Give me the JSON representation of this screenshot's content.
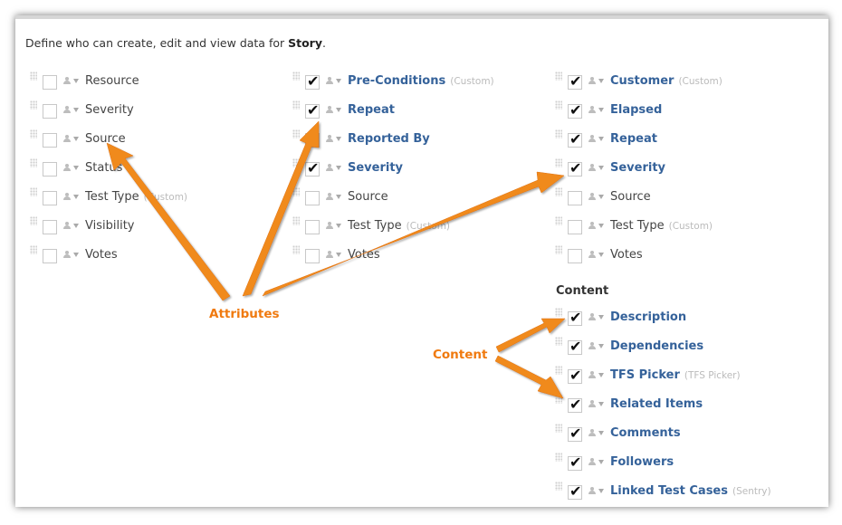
{
  "intro": {
    "prefix": "Define who can create, edit and view data for ",
    "entity": "Story",
    "suffix": "."
  },
  "columns": [
    {
      "items": [
        {
          "label": "Resource",
          "checked": false,
          "tag": ""
        },
        {
          "label": "Severity",
          "checked": false,
          "tag": ""
        },
        {
          "label": "Source",
          "checked": false,
          "tag": ""
        },
        {
          "label": "Status",
          "checked": false,
          "tag": ""
        },
        {
          "label": "Test Type",
          "checked": false,
          "tag": "(Custom)"
        },
        {
          "label": "Visibility",
          "checked": false,
          "tag": ""
        },
        {
          "label": "Votes",
          "checked": false,
          "tag": ""
        }
      ]
    },
    {
      "items": [
        {
          "label": "Pre-Conditions",
          "checked": true,
          "tag": "(Custom)"
        },
        {
          "label": "Repeat",
          "checked": true,
          "tag": ""
        },
        {
          "label": "Reported By",
          "checked": true,
          "tag": ""
        },
        {
          "label": "Severity",
          "checked": true,
          "tag": ""
        },
        {
          "label": "Source",
          "checked": false,
          "tag": ""
        },
        {
          "label": "Test Type",
          "checked": false,
          "tag": "(Custom)"
        },
        {
          "label": "Votes",
          "checked": false,
          "tag": ""
        }
      ]
    },
    {
      "items": [
        {
          "label": "Customer",
          "checked": true,
          "tag": "(Custom)"
        },
        {
          "label": "Elapsed",
          "checked": true,
          "tag": ""
        },
        {
          "label": "Repeat",
          "checked": true,
          "tag": ""
        },
        {
          "label": "Severity",
          "checked": true,
          "tag": ""
        },
        {
          "label": "Source",
          "checked": false,
          "tag": ""
        },
        {
          "label": "Test Type",
          "checked": false,
          "tag": "(Custom)"
        },
        {
          "label": "Votes",
          "checked": false,
          "tag": ""
        }
      ]
    }
  ],
  "content_section": {
    "title": "Content",
    "items": [
      {
        "label": "Description",
        "checked": true,
        "tag": ""
      },
      {
        "label": "Dependencies",
        "checked": true,
        "tag": ""
      },
      {
        "label": "TFS Picker",
        "checked": true,
        "tag": "(TFS Picker)"
      },
      {
        "label": "Related Items",
        "checked": true,
        "tag": ""
      },
      {
        "label": "Comments",
        "checked": true,
        "tag": ""
      },
      {
        "label": "Followers",
        "checked": true,
        "tag": ""
      },
      {
        "label": "Linked Test Cases",
        "checked": true,
        "tag": "(Sentry)"
      }
    ]
  },
  "annotations": {
    "attributes": "Attributes",
    "content": "Content"
  },
  "colors": {
    "accent": "#f07a0f",
    "link": "#35629a"
  },
  "icons": {
    "drag": "drag-handle-icon",
    "role": "person-icon",
    "dropdown": "chevron-down-icon",
    "check": "checkmark-icon"
  }
}
